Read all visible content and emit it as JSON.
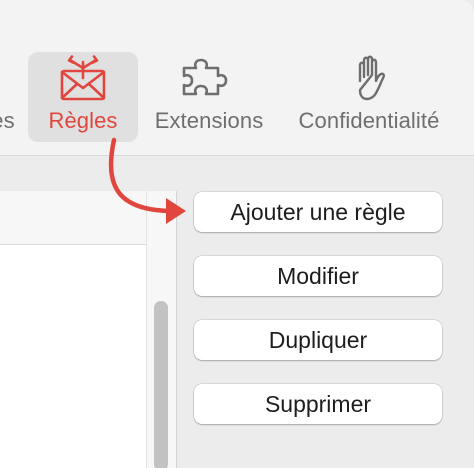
{
  "toolbar": {
    "partial_label": "es",
    "rules_label": "Règles",
    "extensions_label": "Extensions",
    "privacy_label": "Confidentialité"
  },
  "actions": {
    "add_rule": "Ajouter une règle",
    "modify": "Modifier",
    "duplicate": "Dupliquer",
    "delete": "Supprimer"
  },
  "colors": {
    "accent_red": "#e0463d",
    "toolbar_icon_gray": "#6e6e6e"
  },
  "icons": [
    "mail-rules-icon",
    "puzzle-piece-icon",
    "raised-hand-icon",
    "callout-arrow"
  ]
}
